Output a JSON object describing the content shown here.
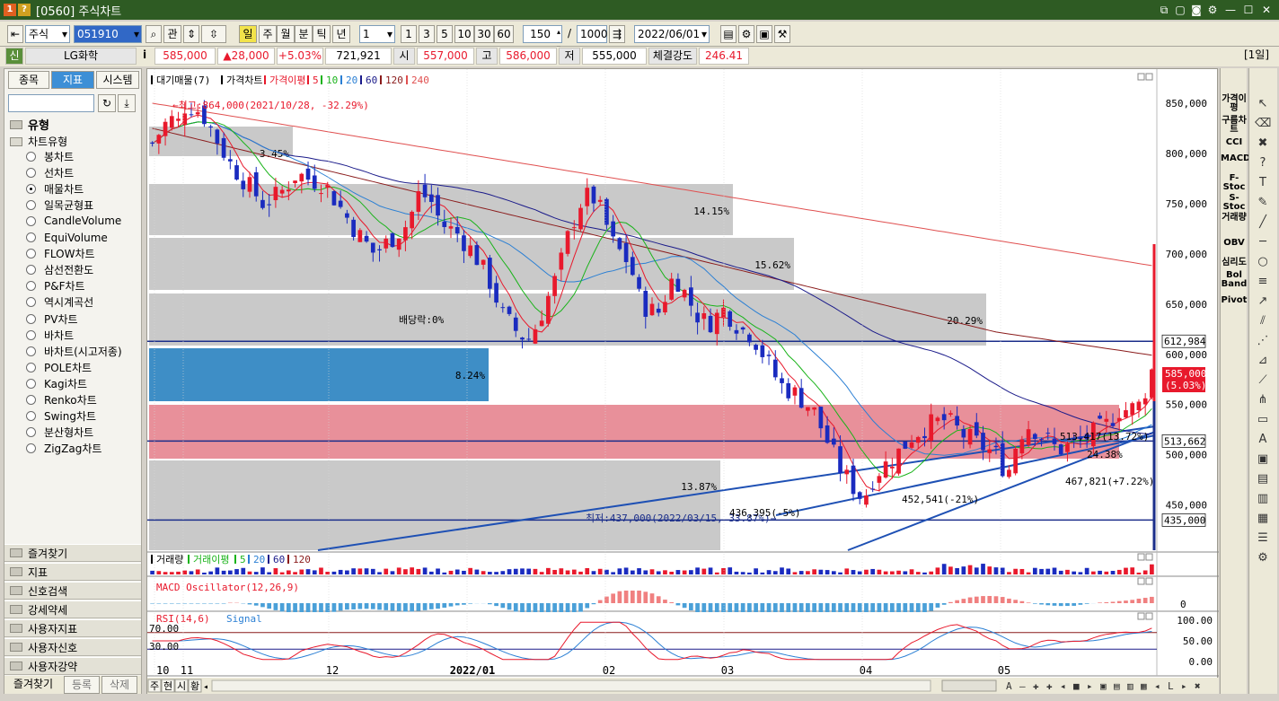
{
  "window": {
    "badge1": "1",
    "badge2": "?",
    "title": "[0560] 주식차트"
  },
  "toolbar": {
    "market": "주식",
    "code": "051910",
    "btn_kwan": "관",
    "periods": [
      "일",
      "주",
      "월",
      "분",
      "틱",
      "년"
    ],
    "period_count": "1",
    "intervals": [
      "1",
      "3",
      "5",
      "10",
      "30",
      "60"
    ],
    "bars": "150",
    "slash": "/",
    "total": "1000",
    "date": "2022/06/01"
  },
  "quote": {
    "flag": "신",
    "name": "LG화학",
    "info": "i",
    "price": "585,000",
    "change": "▲28,000",
    "rate": "+5.03%",
    "volume": "721,921",
    "open_label": "시",
    "open": "557,000",
    "high_label": "고",
    "high": "586,000",
    "low_label": "저",
    "low": "555,000",
    "strength_label": "체결강도",
    "strength": "246.41",
    "period_tag": "[1일]"
  },
  "left_panel": {
    "tabs": [
      "종목",
      "지표",
      "시스템"
    ],
    "section": "유형",
    "tree_root": "차트유형",
    "chart_types": [
      "봉차트",
      "선차트",
      "매물차트",
      "일목균형표",
      "CandleVolume",
      "EquiVolume",
      "FLOW차트",
      "삼선전환도",
      "P&F차트",
      "역시계곡선",
      "PV차트",
      "바차트",
      "바차트(시고저종)",
      "POLE차트",
      "Kagi차트",
      "Renko차트",
      "Swing차트",
      "분산형차트",
      "ZigZag차트"
    ],
    "selected_index": 2,
    "folders": [
      "즐겨찾기",
      "지표",
      "신호검색",
      "강세약세",
      "사용자지표",
      "사용자신호",
      "사용자강약"
    ],
    "bottom": [
      "즐겨찾기",
      "등록",
      "삭제"
    ]
  },
  "price_panel": {
    "legend": [
      "대기매물(7)",
      "가격차트",
      "가격이평",
      "5",
      "10",
      "20",
      "60",
      "120",
      "240"
    ],
    "y_ticks": [
      "850,000",
      "800,000",
      "750,000",
      "700,000",
      "650,000",
      "600,000",
      "550,000",
      "500,000",
      "450,000"
    ],
    "high_note": "←최고:864,000(2021/10/28, -32.29%)",
    "low_note": "최저:437,000(2022/03/15, 33.87%)→",
    "dividend": "배당락:0%",
    "profile_pcts": [
      "3.45%",
      "14.15%",
      "15.62%",
      "20.29%",
      "8.24%",
      "",
      "13.87%"
    ],
    "trend_labels": [
      "452,541(-21%)",
      "467,821(+7.22%)",
      "436,395(-5%)",
      "513,417(13.72%)",
      "24.38%"
    ],
    "price_tags": {
      "line1": "612,984",
      "line2": "513,662",
      "line3": "435,000",
      "current": "585,000",
      "current_rate": "(5.03%)"
    }
  },
  "volume_panel": {
    "legend": [
      "거래량",
      "거래이평",
      "5",
      "20",
      "60",
      "120"
    ]
  },
  "macd_panel": {
    "legend": "MACD Oscillator(12,26,9)",
    "zero": "0"
  },
  "rsi_panel": {
    "legend": [
      "RSI(14,6)",
      "Signal"
    ],
    "levels": [
      "70.00",
      "30.00"
    ],
    "y_ticks": [
      "100.00",
      "50.00",
      "0.00"
    ]
  },
  "x_axis": {
    "labels": [
      "10",
      "11",
      "12",
      "2022/01",
      "02",
      "03",
      "04",
      "05"
    ]
  },
  "bottom_bar": {
    "tabs": [
      "주",
      "현",
      "시",
      "황"
    ]
  },
  "right_indicators": [
    "가격이평",
    "구름차트",
    "CCI",
    "MACD",
    "F-Stoc",
    "S-Stoc",
    "거래량",
    "OBV",
    "심리도",
    "Bol Band",
    "Pivot"
  ],
  "colors": {
    "up": "#e8192c",
    "down": "#1a2bbf",
    "ma5": "#e8192c",
    "ma10": "#19b319",
    "ma20": "#2a7fd4",
    "ma60": "#1b1b8a",
    "ma120": "#8a1b1b",
    "ma240": "#e05050"
  }
}
